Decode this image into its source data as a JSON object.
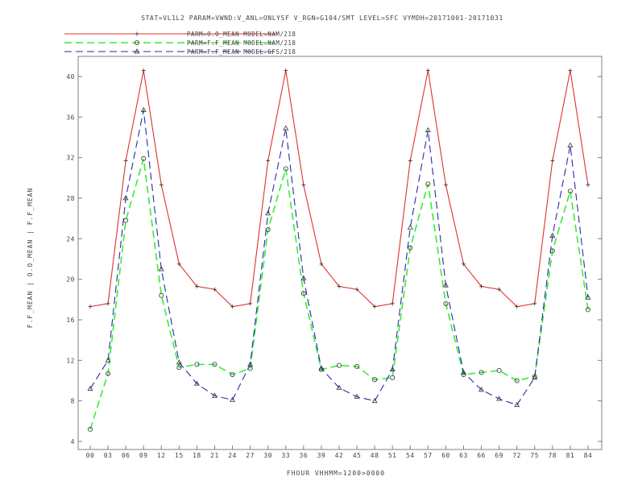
{
  "chart_data": {
    "type": "line",
    "title": "STAT=VL1L2 PARAM=VWND:V_ANL=ONLYSF V_RGN=G104/SMT LEVEL=SFC VYMDH=20171001-20171031",
    "xlabel": "FHOUR VHHMM=1200>0000",
    "ylabel": "F.F_MEAN | O.O_MEAN | F.F_MEAN",
    "ylim": [
      4,
      41
    ],
    "yticks": [
      4,
      8,
      12,
      16,
      20,
      24,
      28,
      32,
      36,
      40
    ],
    "ytick_labels": [
      "4",
      "8",
      "12",
      "16",
      "20",
      "24",
      "28",
      "32",
      "36",
      "40"
    ],
    "categories": [
      "00",
      "03",
      "06",
      "09",
      "12",
      "15",
      "18",
      "21",
      "24",
      "27",
      "30",
      "33",
      "36",
      "39",
      "42",
      "45",
      "48",
      "51",
      "54",
      "57",
      "60",
      "63",
      "66",
      "69",
      "72",
      "75",
      "78",
      "81",
      "84"
    ],
    "series": [
      {
        "name": "PARM=O.O_MEAN MODEL=NAM/218",
        "color": "#e03030",
        "dash": "solid",
        "marker": "plus",
        "values": [
          17.3,
          17.6,
          31.7,
          40.6,
          29.3,
          21.5,
          19.3,
          19.0,
          17.3,
          17.6,
          31.7,
          40.6,
          29.3,
          21.5,
          19.3,
          19.0,
          17.3,
          17.6,
          31.7,
          40.6,
          29.3,
          21.5,
          19.3,
          19.0,
          17.3,
          17.6,
          31.7,
          40.6,
          29.3
        ]
      },
      {
        "name": "PARM=F.F_MEAN MODEL=NAM/218",
        "color": "#33ee33",
        "dash": "long-dash",
        "marker": "circle",
        "values": [
          5.2,
          10.7,
          25.8,
          31.9,
          18.4,
          11.3,
          11.6,
          11.6,
          10.6,
          11.2,
          24.9,
          30.9,
          18.6,
          11.1,
          11.5,
          11.4,
          10.1,
          10.3,
          23.1,
          29.4,
          17.6,
          10.6,
          10.8,
          11.0,
          10.0,
          10.4,
          22.8,
          28.7,
          17.0
        ]
      },
      {
        "name": "PARM=F.F_MEAN MODEL=GFS/218",
        "color": "#2a2aaa",
        "dash": "long-dash",
        "marker": "triangle",
        "values": [
          9.2,
          12.0,
          28.0,
          36.7,
          21.0,
          11.8,
          9.7,
          8.5,
          8.1,
          11.6,
          26.5,
          34.9,
          20.1,
          11.2,
          9.3,
          8.4,
          8.0,
          11.1,
          25.1,
          34.7,
          19.4,
          10.8,
          9.1,
          8.2,
          7.6,
          10.3,
          24.3,
          33.2,
          18.2
        ]
      }
    ],
    "grid": false,
    "legend_position": "top-left"
  }
}
